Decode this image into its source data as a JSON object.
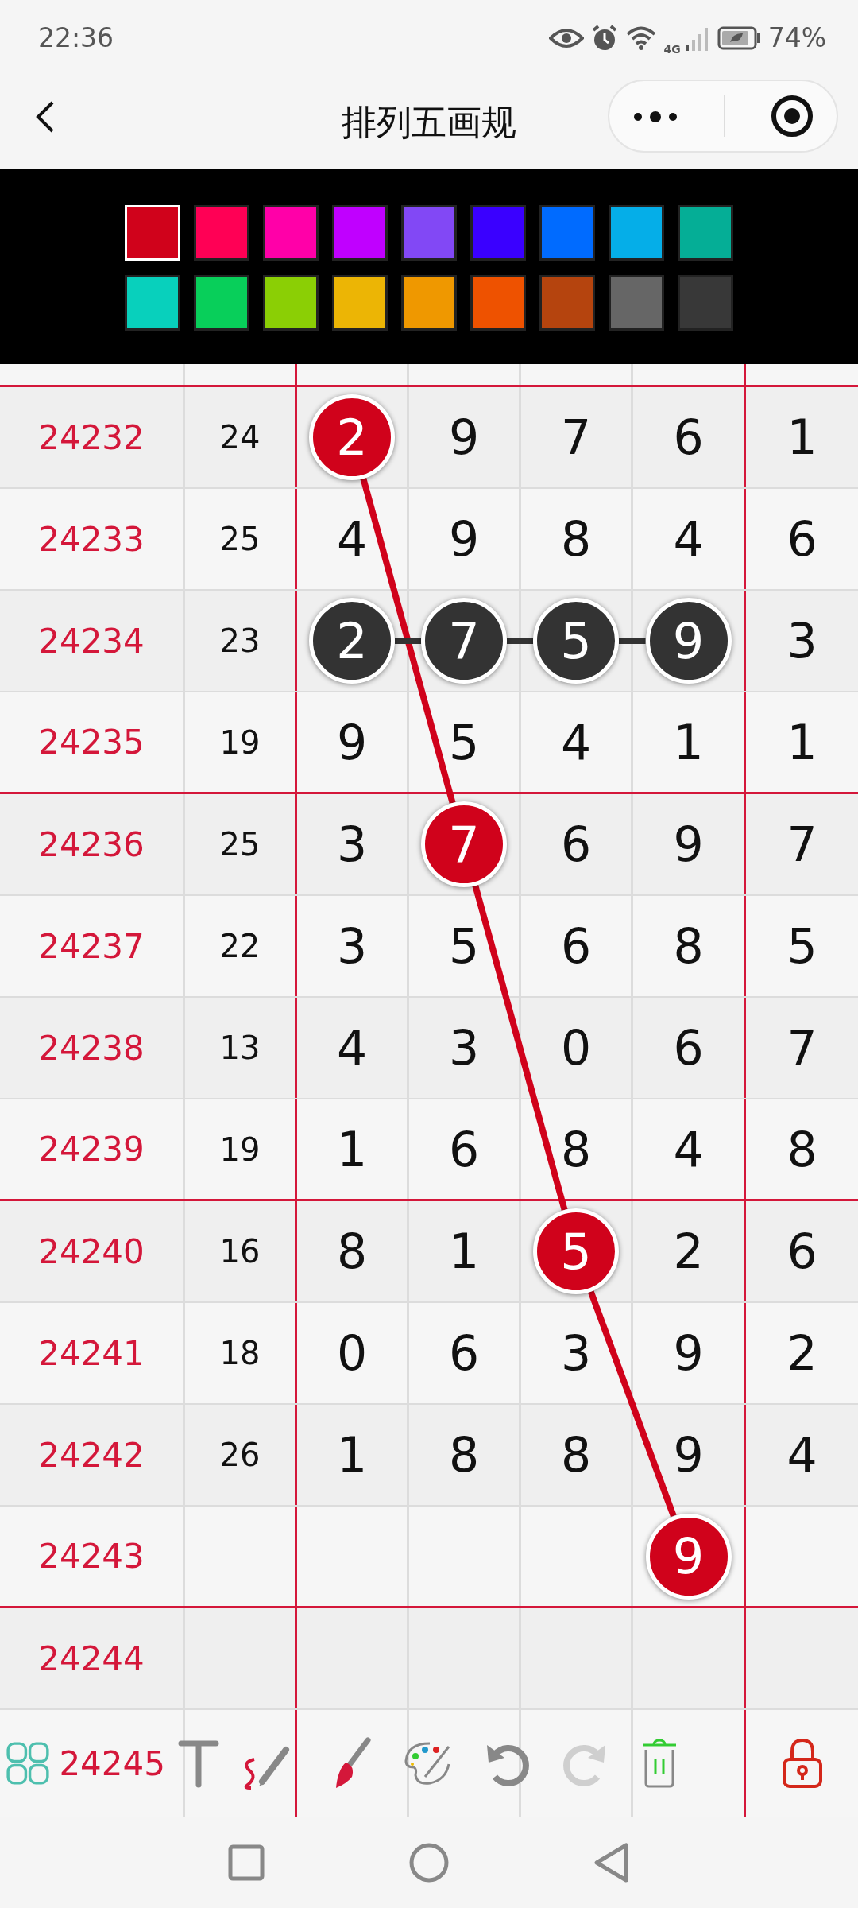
{
  "status_bar": {
    "time": "22:36",
    "network": "4G",
    "battery": "74%"
  },
  "header": {
    "title": "排列五画规"
  },
  "palette": [
    {
      "color": "#d0021b",
      "selected": true
    },
    {
      "color": "#ff0055",
      "selected": false
    },
    {
      "color": "#ff00a8",
      "selected": false
    },
    {
      "color": "#c000ff",
      "selected": false
    },
    {
      "color": "#8248f5",
      "selected": false
    },
    {
      "color": "#3a00ff",
      "selected": false
    },
    {
      "color": "#006bff",
      "selected": false
    },
    {
      "color": "#05aee8",
      "selected": false
    },
    {
      "color": "#05ae96",
      "selected": false
    },
    {
      "color": "#08d0bc",
      "selected": false
    },
    {
      "color": "#08cf5a",
      "selected": false
    },
    {
      "color": "#8bcf05",
      "selected": false
    },
    {
      "color": "#ecb505",
      "selected": false
    },
    {
      "color": "#ef9800",
      "selected": false
    },
    {
      "color": "#ee5200",
      "selected": false
    },
    {
      "color": "#b5440e",
      "selected": false
    },
    {
      "color": "#666666",
      "selected": false
    },
    {
      "color": "#383838",
      "selected": false
    }
  ],
  "table": {
    "rows": [
      {
        "issue": "24232",
        "sum": "24",
        "cells": [
          {
            "value": "2",
            "color": "#d0021b"
          },
          {
            "value": "9"
          },
          {
            "value": "7"
          },
          {
            "value": "6"
          },
          {
            "value": "1"
          }
        ]
      },
      {
        "issue": "24233",
        "sum": "25",
        "cells": [
          {
            "value": "4"
          },
          {
            "value": "9"
          },
          {
            "value": "8"
          },
          {
            "value": "4"
          },
          {
            "value": "6"
          }
        ]
      },
      {
        "issue": "24234",
        "sum": "23",
        "cells": [
          {
            "value": "2",
            "color": "#333333"
          },
          {
            "value": "7",
            "color": "#333333"
          },
          {
            "value": "5",
            "color": "#333333"
          },
          {
            "value": "9",
            "color": "#333333"
          },
          {
            "value": "3"
          }
        ]
      },
      {
        "issue": "24235",
        "sum": "19",
        "cells": [
          {
            "value": "9"
          },
          {
            "value": "5"
          },
          {
            "value": "4"
          },
          {
            "value": "1"
          },
          {
            "value": "1"
          }
        ]
      },
      {
        "issue": "24236",
        "sum": "25",
        "cells": [
          {
            "value": "3"
          },
          {
            "value": "7",
            "color": "#d0021b"
          },
          {
            "value": "6"
          },
          {
            "value": "9"
          },
          {
            "value": "7"
          }
        ]
      },
      {
        "issue": "24237",
        "sum": "22",
        "cells": [
          {
            "value": "3"
          },
          {
            "value": "5"
          },
          {
            "value": "6"
          },
          {
            "value": "8"
          },
          {
            "value": "5"
          }
        ]
      },
      {
        "issue": "24238",
        "sum": "13",
        "cells": [
          {
            "value": "4"
          },
          {
            "value": "3"
          },
          {
            "value": "0"
          },
          {
            "value": "6"
          },
          {
            "value": "7"
          }
        ]
      },
      {
        "issue": "24239",
        "sum": "19",
        "cells": [
          {
            "value": "1"
          },
          {
            "value": "6"
          },
          {
            "value": "8"
          },
          {
            "value": "4"
          },
          {
            "value": "8"
          }
        ]
      },
      {
        "issue": "24240",
        "sum": "16",
        "cells": [
          {
            "value": "8"
          },
          {
            "value": "1"
          },
          {
            "value": "5",
            "color": "#d0021b"
          },
          {
            "value": "2"
          },
          {
            "value": "6"
          }
        ]
      },
      {
        "issue": "24241",
        "sum": "18",
        "cells": [
          {
            "value": "0"
          },
          {
            "value": "6"
          },
          {
            "value": "3"
          },
          {
            "value": "9"
          },
          {
            "value": "2"
          }
        ]
      },
      {
        "issue": "24242",
        "sum": "26",
        "cells": [
          {
            "value": "1"
          },
          {
            "value": "8"
          },
          {
            "value": "8"
          },
          {
            "value": "9"
          },
          {
            "value": "4"
          }
        ]
      },
      {
        "issue": "24243",
        "cells": [
          {},
          {},
          {},
          {
            "value": "9",
            "color": "#d0021b"
          },
          {}
        ]
      },
      {
        "issue": "24244",
        "cells": [
          {},
          {},
          {},
          {},
          {}
        ]
      },
      {
        "issue": "24245",
        "cells": [
          {},
          {},
          {},
          {},
          {}
        ]
      }
    ]
  },
  "toolbar": [
    {
      "kind": "grid",
      "disabled": false
    },
    {
      "kind": "text",
      "disabled": false
    },
    {
      "kind": "pen",
      "disabled": false
    },
    {
      "kind": "brush",
      "disabled": false
    },
    {
      "kind": "palette",
      "disabled": false
    },
    {
      "kind": "undo",
      "disabled": false
    },
    {
      "kind": "redo",
      "disabled": true
    },
    {
      "kind": "trash",
      "disabled": false
    },
    {
      "kind": "lock",
      "disabled": false
    }
  ]
}
